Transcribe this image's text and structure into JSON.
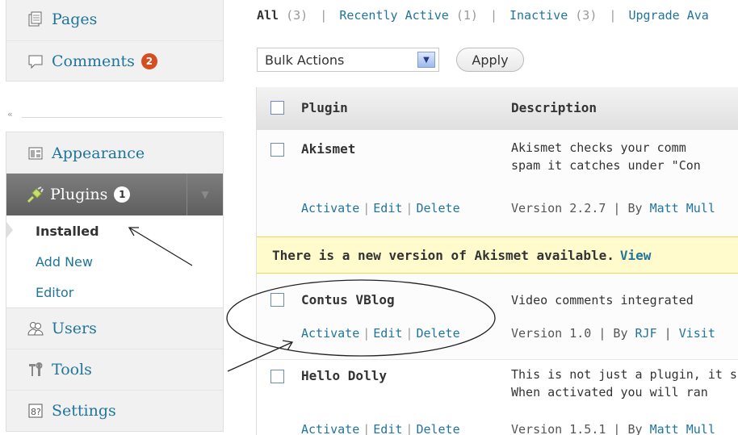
{
  "sidebar": {
    "top_items": [
      {
        "label": "Pages",
        "icon": "pages-icon"
      },
      {
        "label": "Comments",
        "icon": "comments-icon",
        "badge": "2",
        "badge_color": "#d54e21"
      }
    ],
    "collapse_glyph": "«",
    "mid_item": {
      "label": "Appearance",
      "icon": "appearance-icon"
    },
    "plugins": {
      "label": "Plugins",
      "badge": "1",
      "submenu": [
        "Installed",
        "Add New",
        "Editor"
      ]
    },
    "bottom_items": [
      {
        "label": "Users",
        "icon": "users-icon"
      },
      {
        "label": "Tools",
        "icon": "tools-icon"
      },
      {
        "label": "Settings",
        "icon": "settings-icon"
      }
    ]
  },
  "filters": {
    "all": "All",
    "all_count": "(3)",
    "recent": "Recently Active",
    "recent_count": "(1)",
    "inactive": "Inactive",
    "inactive_count": "(3)",
    "upgrade": "Upgrade Ava"
  },
  "toolbar": {
    "bulk_label": "Bulk Actions",
    "apply_label": "Apply"
  },
  "table": {
    "headers": {
      "plugin": "Plugin",
      "description": "Description"
    },
    "action_labels": [
      "Activate",
      "Edit",
      "Delete"
    ],
    "rows": [
      {
        "name": "Akismet",
        "desc1": "Akismet checks your comm",
        "desc2": "spam it catches under \"Con",
        "version_text": "Version 2.2.7 | By ",
        "author": "Matt Mull"
      },
      {
        "name": "Contus VBlog",
        "desc1": "Video comments integrated",
        "desc2": "",
        "version_text": "Version 1.0 | By ",
        "author": "RJF",
        "extra_sep": " | ",
        "extra_link": "Visit"
      },
      {
        "name": "Hello Dolly",
        "desc1": "This is not just a plugin, it s",
        "desc2": "When activated you will ran",
        "version_text": "Version 1.5.1 | By ",
        "author": "Matt Mull"
      }
    ],
    "update_notice": {
      "text": "There is a new version of Akismet available.",
      "link": "View"
    }
  },
  "colors": {
    "link": "#21759b",
    "badge": "#d54e21",
    "plugins_header": "#6d6d6d",
    "update_bg": "#fffbcc"
  }
}
